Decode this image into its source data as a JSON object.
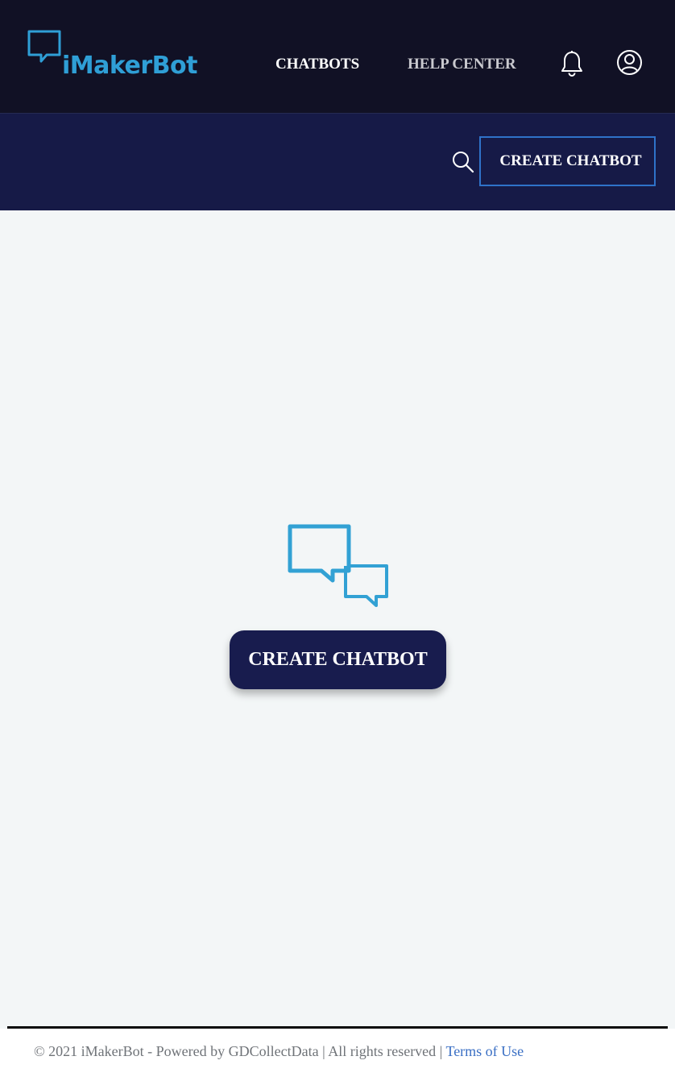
{
  "header": {
    "logo_text": "iMakerBot",
    "nav": {
      "chatbots_label": "CHATBOTS",
      "help_center_label": "HELP CENTER"
    },
    "icons": {
      "logo": "chat-bubble-icon",
      "notifications": "bell-icon",
      "account": "user-circle-icon"
    }
  },
  "toolbar": {
    "search_icon": "search-icon",
    "create_button_label": "CREATE CHATBOT"
  },
  "main": {
    "empty_state_icon": "chat-bubbles-icon",
    "create_button_label": "CREATE CHATBOT"
  },
  "footer": {
    "copyright": "© 2021 iMakerBot - Powered by GDCollectData | All rights reserved | ",
    "terms_label": "Terms of Use"
  },
  "colors": {
    "header_bg": "#111125",
    "subbar_bg": "#161a47",
    "brand_blue": "#2f9fd6",
    "button_dark": "#181c4e",
    "outline_blue": "#2f72c9",
    "page_bg": "#f3f6f7",
    "link_blue": "#3a6fc4"
  }
}
